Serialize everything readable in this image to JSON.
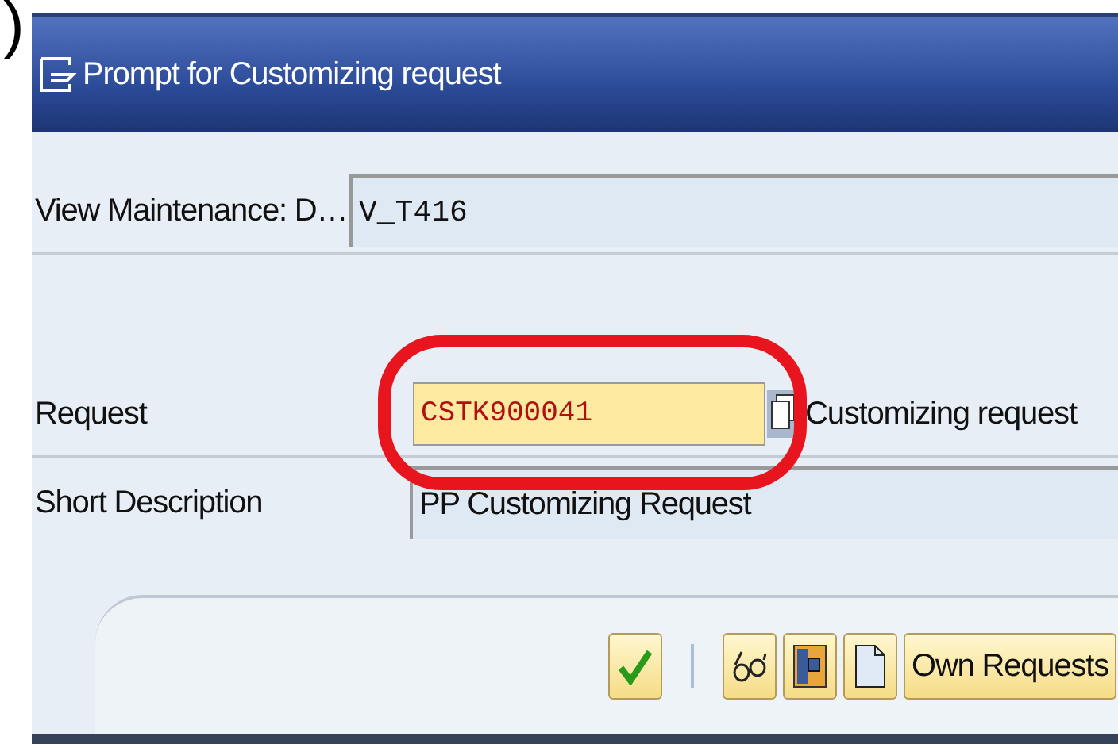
{
  "fragment": ")",
  "window": {
    "title": "Prompt for Customizing request"
  },
  "fields": [
    {
      "label": "View Maintenance: D…",
      "value": "V_T416",
      "kind": "readonly"
    },
    {
      "label": "Request",
      "value": "CSTK900041",
      "kind": "input",
      "hint": "Customizing request"
    },
    {
      "label": "Short Description",
      "value": "PP Customizing Request",
      "kind": "readonly"
    }
  ],
  "buttons": [
    {
      "kind": "check"
    },
    {
      "kind": "glasses"
    },
    {
      "kind": "panel"
    },
    {
      "kind": "page"
    },
    {
      "kind": "text",
      "label": "Own Requests"
    }
  ]
}
